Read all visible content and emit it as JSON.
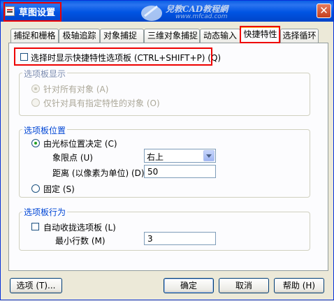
{
  "window": {
    "title": "草图设置",
    "close_glyph": "✕",
    "watermark_text": "兒教CAD教程網",
    "watermark_url": "www.mfcad.com"
  },
  "tabs": [
    {
      "label": "捕捉和栅格",
      "active": false
    },
    {
      "label": "极轴追踪",
      "active": false
    },
    {
      "label": "对象捕捉",
      "active": false
    },
    {
      "label": "三维对象捕捉",
      "active": false
    },
    {
      "label": "动态输入",
      "active": false
    },
    {
      "label": "快捷特性",
      "active": true
    },
    {
      "label": "选择循环",
      "active": false
    }
  ],
  "quick_props": {
    "show_on_select_label": "选择时显示快捷特性选项板 (CTRL+SHIFT+P) (Q)",
    "show_on_select_checked": false
  },
  "palette_display": {
    "title": "选项板显示",
    "all_objects_label": "针对所有对象 (A)",
    "all_objects_checked": true,
    "specified_objects_label": "仅针对具有指定特性的对象 (O)",
    "specified_objects_checked": false,
    "enabled": false
  },
  "palette_location": {
    "title": "选项板位置",
    "cursor_label": "由光标位置决定 (C)",
    "cursor_checked": true,
    "quadrant_label": "象限点 (U)",
    "quadrant_value": "右上",
    "distance_label": "距离 (以像素为单位) (D)",
    "distance_value": "50",
    "static_label": "固定 (S)",
    "static_checked": false
  },
  "palette_behavior": {
    "title": "选项板行为",
    "auto_collapse_label": "自动收拢选项板 (L)",
    "auto_collapse_checked": false,
    "min_rows_label": "最小行数 (M)",
    "min_rows_value": "3"
  },
  "buttons": {
    "options": "选项 (T)...",
    "ok": "确定",
    "cancel": "取消",
    "help": "帮助 (H)"
  },
  "colors": {
    "titlebar": "#0054e3",
    "highlight": "#e00000",
    "group_title": "#0046d5"
  }
}
